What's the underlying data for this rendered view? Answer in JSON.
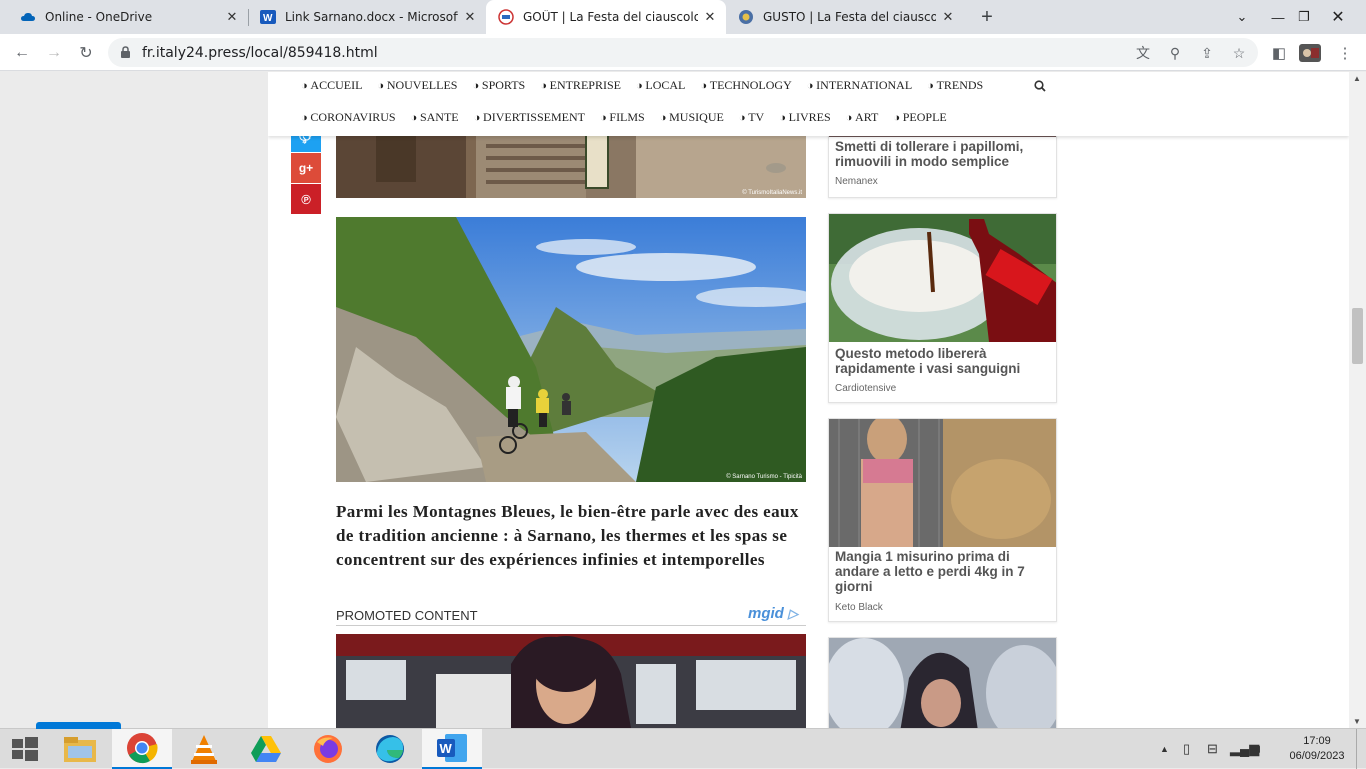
{
  "browser": {
    "tabs": [
      {
        "title": "Online - OneDrive",
        "icon": "onedrive-icon"
      },
      {
        "title": "Link Sarnano.docx - Microsoft Word Online",
        "icon": "word-icon"
      },
      {
        "title": "GOÛT | La Festa del ciauscolo à Sarnano",
        "icon": "italy24-icon",
        "active": true
      },
      {
        "title": "GUSTO | La Festa del ciauscolo a Sarnano",
        "icon": "site-icon"
      }
    ],
    "url": "fr.italy24.press/local/859418.html"
  },
  "site": {
    "nav_row1": [
      "ACCUEIL",
      "NOUVELLES",
      "SPORTS",
      "ENTREPRISE",
      "LOCAL",
      "TECHNOLOGY",
      "INTERNATIONAL",
      "TRENDS"
    ],
    "nav_row2": [
      "CORONAVIRUS",
      "SANTE",
      "DIVERTISSEMENT",
      "FILMS",
      "MUSIQUE",
      "TV",
      "LIVRES",
      "ART",
      "PEOPLE"
    ]
  },
  "article": {
    "credit1": "© TurismoItaliaNews.it",
    "credit2": "© Sarnano Turismo - Tipicità",
    "caption": "Parmi les Montagnes Bleues, le bien-être parle avec des eaux de tradition ancienne : à Sarnano, les thermes et les spas se concentrent sur des expériences infinies et intemporelles",
    "promoted_label": "PROMOTED CONTENT",
    "promo_brand": "mgid"
  },
  "ads": [
    {
      "title": "Smetti di tollerare i papillomi, rimuovili in modo semplice",
      "source": "Nemanex"
    },
    {
      "title": "Questo metodo libererà rapidamente i vasi sanguigni",
      "source": "Cardiotensive"
    },
    {
      "title": "Mangia 1 misurino prima di andare a letto e perdi 4kg in 7 giorni",
      "source": "Keto Black"
    }
  ],
  "taskbar": {
    "time": "17:09",
    "date": "06/09/2023"
  },
  "colors": {
    "twitter": "#1da1f2",
    "googleplus": "#dd4b39",
    "pinterest": "#cb2027",
    "accent": "#0078d7"
  }
}
